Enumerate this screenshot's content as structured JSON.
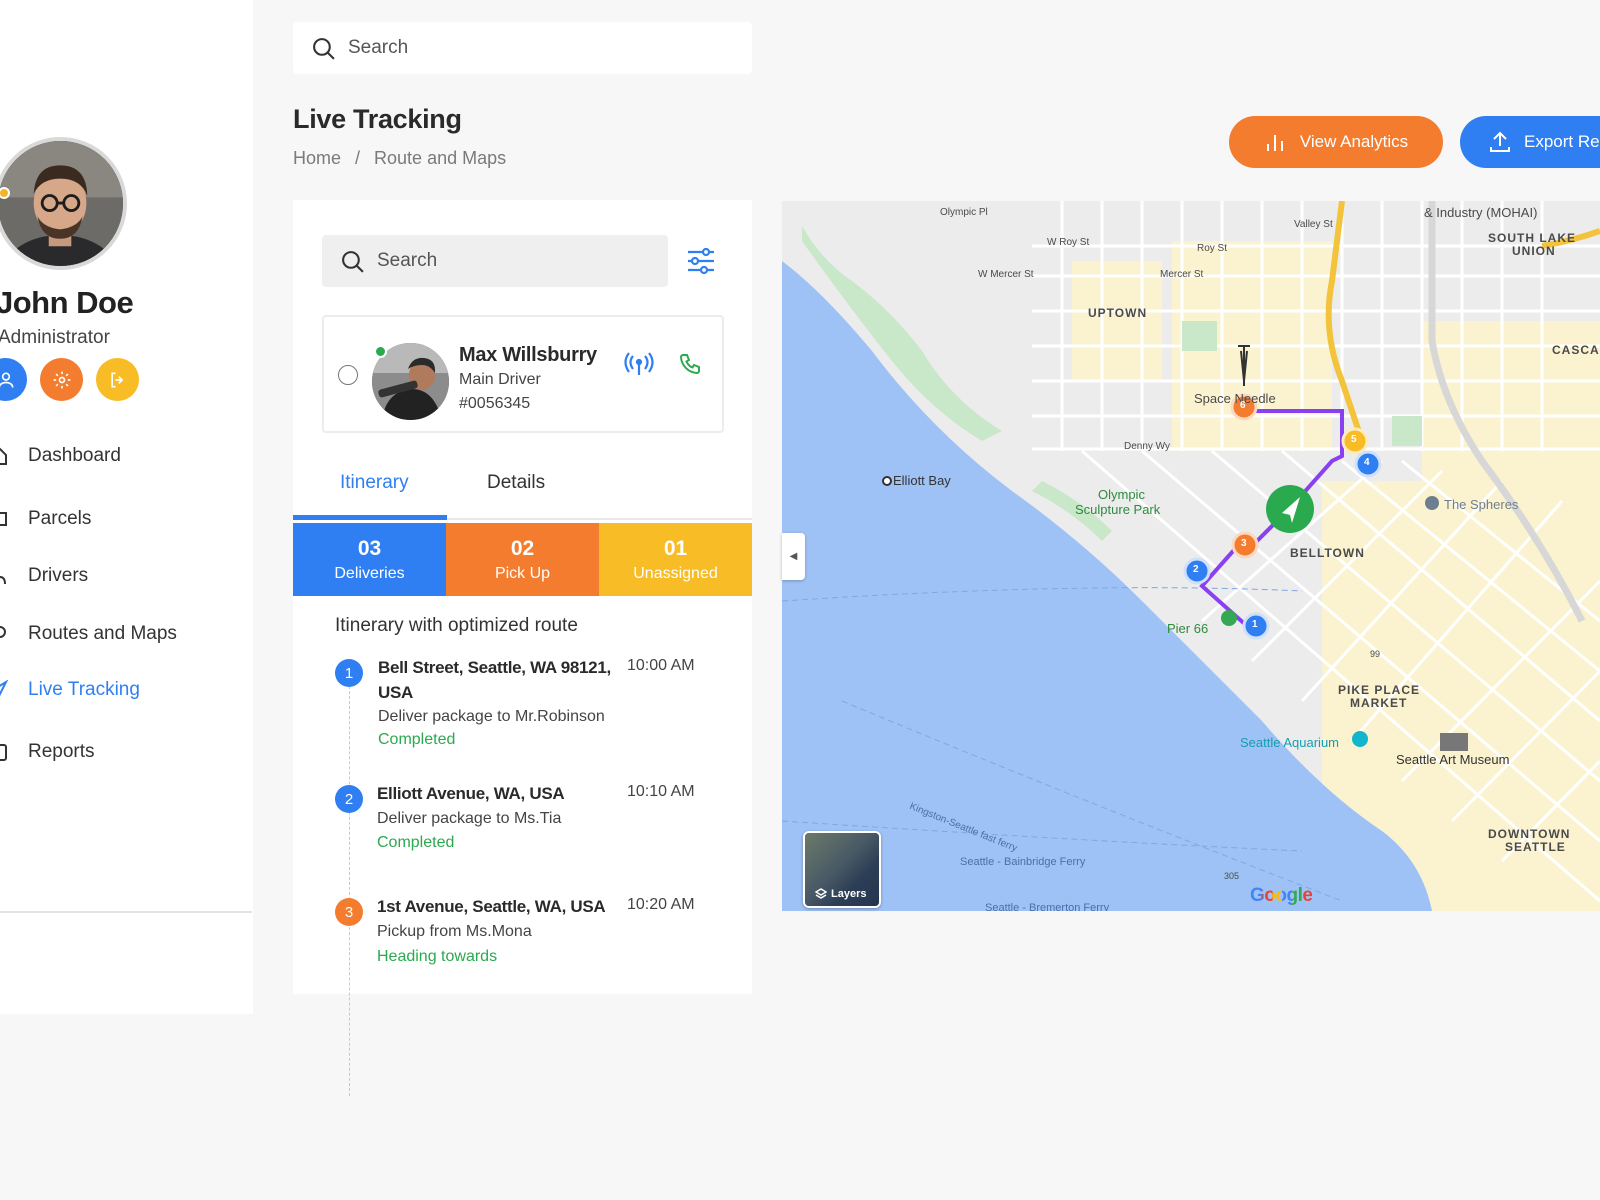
{
  "user": {
    "name": "John Doe",
    "role": "Administrator"
  },
  "nav": {
    "items": [
      {
        "label": "Dashboard",
        "icon": "home-icon"
      },
      {
        "label": "Parcels",
        "icon": "box-icon"
      },
      {
        "label": "Drivers",
        "icon": "person-icon"
      },
      {
        "label": "Routes and Maps",
        "icon": "pin-icon"
      },
      {
        "label": "Live Tracking",
        "icon": "navigation-icon",
        "active": true
      },
      {
        "label": "Reports",
        "icon": "file-icon"
      }
    ]
  },
  "search": {
    "placeholder": "Search"
  },
  "header": {
    "title": "Live Tracking",
    "breadcrumb": [
      "Home",
      "/",
      "Route and Maps"
    ],
    "analytics_label": "View Analytics",
    "export_label": "Export Rep"
  },
  "panel": {
    "search_placeholder": "Search",
    "driver": {
      "name": "Max Willsburry",
      "role": "Main Driver",
      "id": "#0056345"
    },
    "tabs": [
      "Itinerary",
      "Details"
    ],
    "stats": [
      {
        "num": "03",
        "label": "Deliveries"
      },
      {
        "num": "02",
        "label": "Pick Up"
      },
      {
        "num": "01",
        "label": "Unassigned"
      }
    ],
    "itinerary_heading": "Itinerary with optimized route",
    "stops": [
      {
        "num": "1",
        "address": "Bell Street, Seattle, WA 98121, USA",
        "time": "10:00 AM",
        "desc": "Deliver package to Mr.Robinson",
        "status": "Completed"
      },
      {
        "num": "2",
        "address": "Elliott Avenue, WA, USA",
        "time": "10:10 AM",
        "desc": "Deliver package to Ms.Tia",
        "status": "Completed"
      },
      {
        "num": "3",
        "address": "1st Avenue, Seattle, WA, USA",
        "time": "10:20 AM",
        "desc": "Pickup from Ms.Mona",
        "status": "Heading towards"
      }
    ]
  },
  "map": {
    "labels": {
      "industry": "& Industry (MOHAI)",
      "south_lake_1": "SOUTH LAKE",
      "south_lake_2": "UNION",
      "cascade": "CASCAD",
      "uptown": "UPTOWN",
      "space_needle": "Space Needle",
      "elliott_bay": "Elliott Bay",
      "olympic_1": "Olympic",
      "olympic_2": "Sculpture Park",
      "belltown": "BELLTOWN",
      "spheres": "The Spheres",
      "pier66": "Pier 66",
      "pike_1": "PIKE PLACE",
      "pike_2": "MARKET",
      "aquarium": "Seattle Aquarium",
      "art_museum": "Seattle Art Museum",
      "downtown_1": "DOWNTOWN",
      "downtown_2": "SEATTLE",
      "ferry1": "Seattle - Bainbridge Ferry",
      "ferry2": "Seattle - Bremerton Ferry",
      "kingston": "Kingston-Seattle fast ferry",
      "denny": "Denny Wy",
      "w_roy": "W Roy St",
      "roy": "Roy St",
      "mercer": "Mercer St",
      "w_mercer": "W Mercer St",
      "valley": "Valley St",
      "olympic_pl": "Olympic Pl",
      "hwy99": "99",
      "hwy305": "305"
    },
    "markers": [
      "1",
      "2",
      "3",
      "4",
      "5",
      "6"
    ],
    "layers_label": "Layers",
    "google": "Google"
  },
  "colors": {
    "blue": "#2f7ff2",
    "orange": "#f47c2f",
    "yellow": "#f8bc27",
    "green": "#2ba94f",
    "route": "#8a3ff0"
  }
}
